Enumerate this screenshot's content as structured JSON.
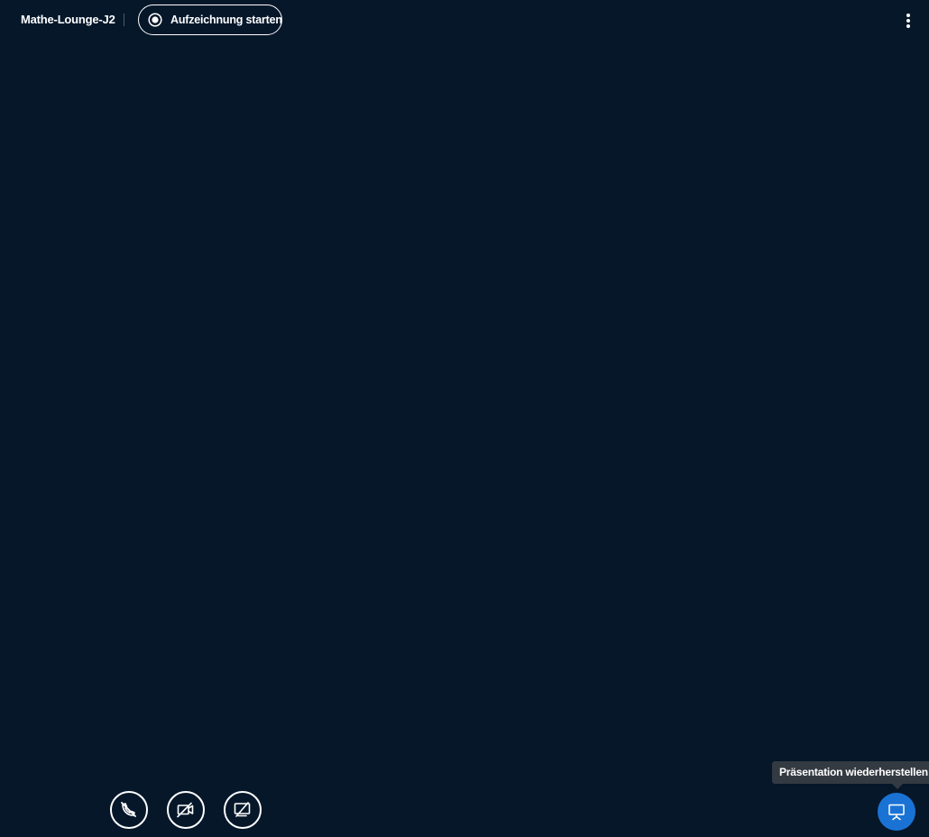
{
  "topbar": {
    "meeting_title": "Mathe-Lounge-J2",
    "record_button_label": "Aufzeichnung starten",
    "options_icon": "vertical-dots-icon"
  },
  "controls": {
    "audio_icon": "phone-off-icon",
    "video_icon": "camera-off-icon",
    "screen_icon": "screen-share-off-icon"
  },
  "presentation": {
    "tooltip": "Präsentation wiederherstellen",
    "restore_icon": "presentation-icon"
  },
  "colors": {
    "background": "#06172a",
    "accent": "#1a73d4",
    "tooltip_bg": "#333a42"
  }
}
